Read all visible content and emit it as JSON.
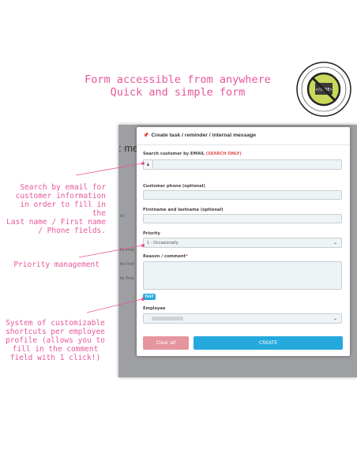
{
  "headline": {
    "line1": "Form accessible from anywhere",
    "line2": "Quick and simple form"
  },
  "annotations": {
    "search": [
      "Search by email for",
      "customer information",
      "in order to fill in the",
      "Last name / First name",
      "/ Phone fields."
    ],
    "priority": "Priority management",
    "shortcuts": [
      "System of customizable",
      "shortcuts per employee",
      "profile (allows you to",
      "fill in the comment",
      "field with 1 click!)"
    ]
  },
  "background_app": {
    "heading_fragment": ": me",
    "tab_fragment": "tat",
    "row_label": "for Fred"
  },
  "modal": {
    "title": "Create task / reminder / internal message",
    "title_icon": "pin-icon",
    "search_label": "Search customer by EMAIL",
    "search_note": "(SEARCH ONLY)",
    "search_value": "",
    "phone_label": "Customer phone (optional)",
    "phone_value": "",
    "name_label": "Firstname and lastname (optional)",
    "name_value": "",
    "priority_label": "Priority",
    "priority_value": "1 - Occasionally",
    "reason_label": "Reason / comment",
    "reason_required": "*",
    "reason_value": "",
    "shortcut_tag": "TEST",
    "employee_label": "Employee",
    "clear_label": "Clear all",
    "create_label": "CREATE"
  },
  "colors": {
    "annotation": "#e7579a",
    "create_button": "#25a9dd",
    "clear_button": "#e5959e",
    "required": "#e05050"
  },
  "badge": {
    "icon": "no-code-badge",
    "text": "</CODE>"
  }
}
